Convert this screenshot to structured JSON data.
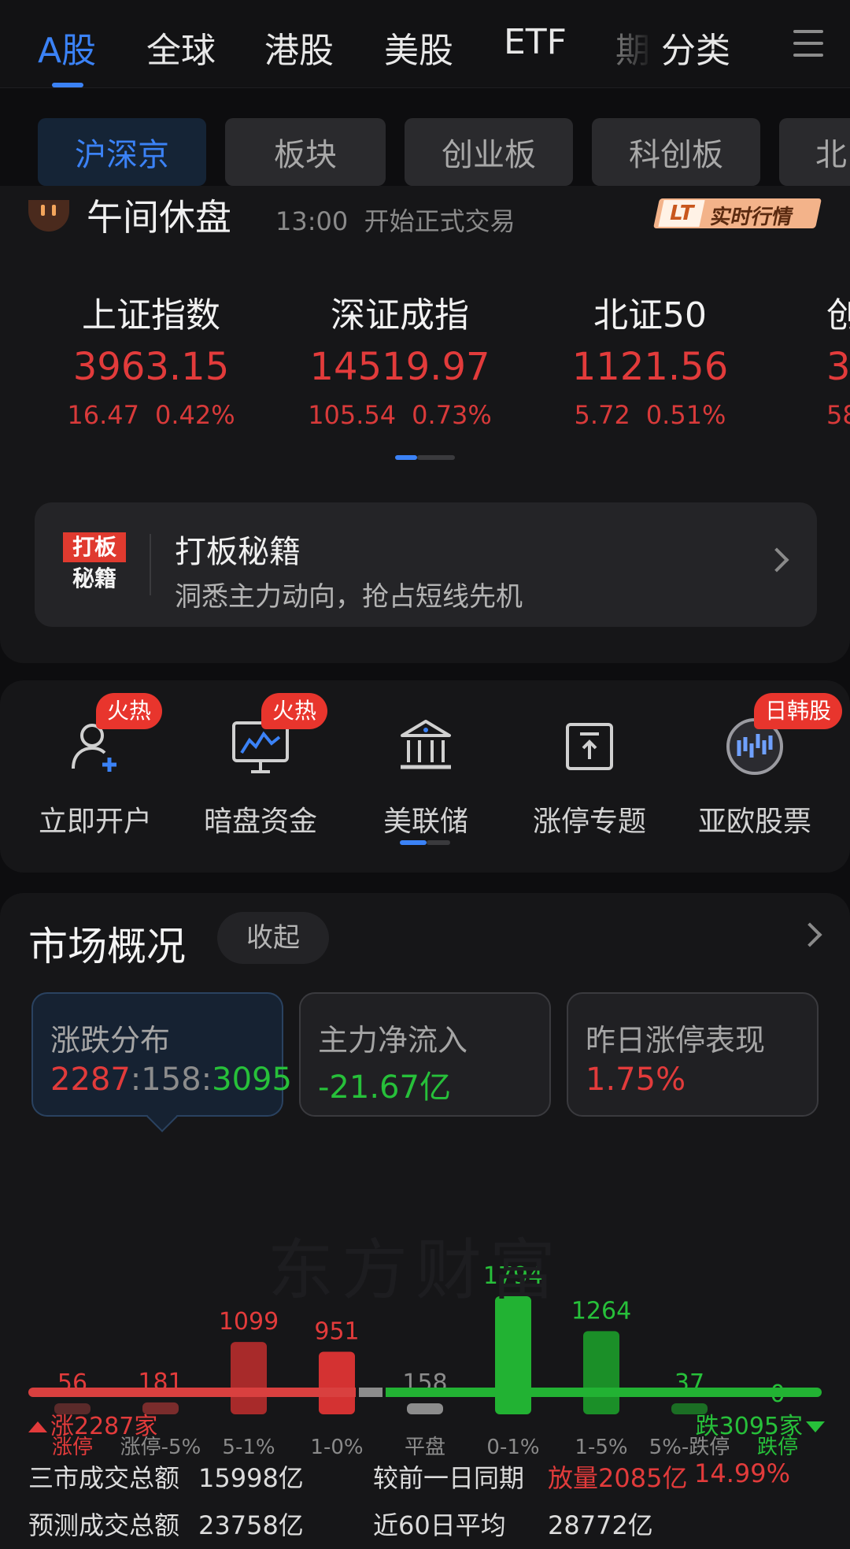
{
  "top_tabs": [
    "A股",
    "全球",
    "港股",
    "美股",
    "ETF",
    "期",
    "分类"
  ],
  "sub_tabs": [
    "沪深京",
    "板块",
    "创业板",
    "科创板",
    "北"
  ],
  "status": {
    "title": "午间休盘",
    "time": "13:00",
    "text": "开始正式交易",
    "badge_lt": "LT",
    "badge_text": "实时行情"
  },
  "indices": [
    {
      "name": "上证指数",
      "value": "3963.15",
      "change": "16.47",
      "pct": "0.42%"
    },
    {
      "name": "深证成指",
      "value": "14519.97",
      "change": "105.54",
      "pct": "0.73%"
    },
    {
      "name": "北证50",
      "value": "1121.56",
      "change": "5.72",
      "pct": "0.51%"
    },
    {
      "name": "创",
      "value": "3",
      "change": "58.",
      "pct": ""
    }
  ],
  "promo": {
    "logo_top": "打板",
    "logo_bottom": "秘籍",
    "title": "打板秘籍",
    "subtitle": "洞悉主力动向，抢占短线先机"
  },
  "tools": [
    {
      "label": "立即开户",
      "tag": "火热"
    },
    {
      "label": "暗盘资金",
      "tag": "火热"
    },
    {
      "label": "美联储",
      "tag": ""
    },
    {
      "label": "涨停专题",
      "tag": ""
    },
    {
      "label": "亚欧股票",
      "tag": "日韩股"
    }
  ],
  "market": {
    "title": "市场概况",
    "collapse": "收起",
    "cards": [
      {
        "title": "涨跌分布",
        "up": "2287",
        "flat": "158",
        "down": "3095"
      },
      {
        "title": "主力净流入",
        "value": "-21.67亿"
      },
      {
        "title": "昨日涨停表现",
        "value": "1.75%"
      }
    ],
    "watermark": "东方财富",
    "up_label": "涨2287家",
    "down_label": "跌3095家",
    "stats": {
      "total_label": "三市成交总额",
      "total_value": "15998亿",
      "compare_label": "较前一日同期",
      "compare_value": "放量2085亿",
      "compare_pct": "14.99%",
      "forecast_label": "预测成交总额",
      "forecast_value": "23758亿",
      "avg_label": "近60日平均",
      "avg_value": "28772亿"
    }
  },
  "colors": {
    "up": "#e23b3b",
    "down": "#27c03a",
    "flat": "#8c8c8c",
    "accent": "#3b82f6"
  },
  "chart_data": {
    "type": "bar",
    "categories": [
      "涨停",
      "涨停-5%",
      "5-1%",
      "1-0%",
      "平盘",
      "0-1%",
      "1-5%",
      "5%-跌停",
      "跌停"
    ],
    "values": [
      56,
      181,
      1099,
      951,
      158,
      1794,
      1264,
      37,
      0
    ],
    "colors": [
      "#5a2a2a",
      "#7a2c2c",
      "#a82a2a",
      "#d43232",
      "#8c8c8c",
      "#22b233",
      "#1b8f28",
      "#1b6e24",
      "#1b6e24"
    ],
    "label_colors": [
      "#e23b3b",
      "#e23b3b",
      "#e23b3b",
      "#e23b3b",
      "#8c8c8c",
      "#27c03a",
      "#27c03a",
      "#27c03a",
      "#27c03a"
    ],
    "category_colors": [
      "#e23b3b",
      "#8a8a8a",
      "#8a8a8a",
      "#8a8a8a",
      "#8a8a8a",
      "#8a8a8a",
      "#8a8a8a",
      "#8a8a8a",
      "#27c03a"
    ]
  }
}
